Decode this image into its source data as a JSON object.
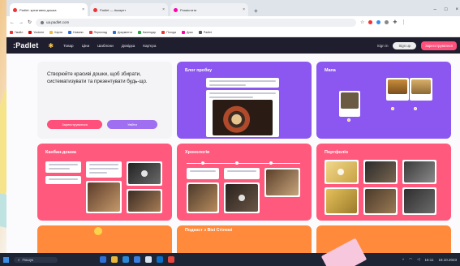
{
  "browser": {
    "tabs": [
      {
        "label": "Padlet: креативна дошка",
        "active": true
      },
      {
        "label": "Padlet — Аккаунт",
        "active": false
      },
      {
        "label": "Розмістити",
        "active": false
      }
    ],
    "url": "ua.padlet.com",
    "bookmarks": [
      "Гмайл",
      "Youtube",
      "Карти",
      "Новини",
      "Переклад",
      "Документи",
      "Календар",
      "Погода",
      "Диск",
      "Padlet"
    ]
  },
  "padlet": {
    "logo": ":Padlet",
    "nav": [
      "Товар",
      "Ціни",
      "Шаблони",
      "Довідка",
      "Кар'єра"
    ],
    "login": "Sign in",
    "signup_top": "Sign up",
    "signup_pink": "Зареєструватися"
  },
  "hero": {
    "text": "Створюйте красиві дошки, щоб збирати, систематизувати та презентувати будь-що.",
    "btn_signup": "Зареєструватися",
    "btn_login": "Увійти"
  },
  "cards": {
    "blog": "Блог пробку",
    "map": "Мапа",
    "kanban": "Канбан-дошка",
    "timeline": "Хронологія",
    "portfolio": "Портфоліо",
    "bottom_mid": "Подкаст з Вікі Стілемі"
  },
  "taskbar": {
    "search": "Пошук",
    "time": "16:11",
    "date": "18.10.2023"
  },
  "colors": {
    "pink": "#ff5a7e",
    "purple": "#8b57f0",
    "orange": "#ff8a3c",
    "header": "#1e1e2f"
  }
}
